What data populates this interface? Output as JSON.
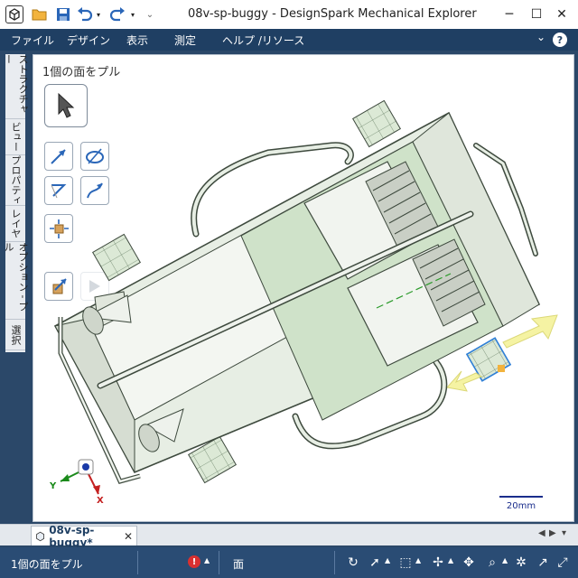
{
  "window": {
    "title": "08v-sp-buggy - DesignSpark Mechanical Explorer"
  },
  "menu": {
    "items": [
      "ファイル",
      "デザイン",
      "表示",
      "測定",
      "ヘルプ /リソース"
    ]
  },
  "side_tabs": [
    "ストラクチャー",
    "ビュー",
    "プロパティ",
    "レイヤ",
    "オプション - プル",
    "選択"
  ],
  "viewport": {
    "prompt": "1個の面をプル",
    "scale_label": "20mm",
    "axes": {
      "x": "X",
      "y": "Y"
    }
  },
  "document_tab": {
    "label": "08v-sp-buggy*",
    "close": "✕"
  },
  "status": {
    "text": "1個の面をプル",
    "selection": "面",
    "error_icon": "!"
  },
  "colors": {
    "menubar": "#1f3f63",
    "statusbar": "#2a4c74",
    "model_fill": "#e7eee4",
    "model_edge": "#3e4a3e",
    "face_highlight": "#cfe2c9",
    "selection": "#2f7fd6",
    "pull_arrow": "#f5f29a"
  },
  "icons": [
    "app-icon",
    "open-folder-icon",
    "save-icon",
    "undo-icon",
    "redo-icon",
    "minimize-icon",
    "maximize-icon",
    "close-icon",
    "help-icon"
  ]
}
